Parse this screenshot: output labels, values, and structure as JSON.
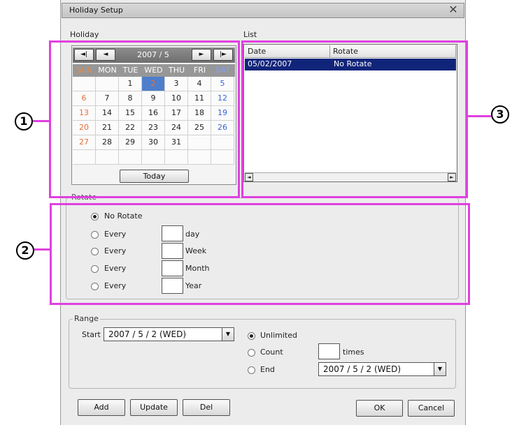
{
  "window": {
    "title": "Holiday Setup"
  },
  "holiday": {
    "section_label": "Holiday",
    "calendar": {
      "month_label": "2007 / 5",
      "nav": {
        "prev_year": "◄|",
        "prev_month": "◄",
        "next_month": "►",
        "next_year": "|►"
      },
      "weekdays": [
        "SUN",
        "MON",
        "TUE",
        "WED",
        "THU",
        "FRI",
        "SAT"
      ],
      "weeks": [
        [
          "",
          "",
          "1",
          "2",
          "3",
          "4",
          "5"
        ],
        [
          "6",
          "7",
          "8",
          "9",
          "10",
          "11",
          "12"
        ],
        [
          "13",
          "14",
          "15",
          "16",
          "17",
          "18",
          "19"
        ],
        [
          "20",
          "21",
          "22",
          "23",
          "24",
          "25",
          "26"
        ],
        [
          "27",
          "28",
          "29",
          "30",
          "31",
          "",
          ""
        ],
        [
          "",
          "",
          "",
          "",
          "",
          "",
          ""
        ]
      ],
      "selected_day": "2",
      "today_label": "Today"
    }
  },
  "list": {
    "section_label": "List",
    "columns": [
      "Date",
      "Rotate"
    ],
    "rows": [
      {
        "date": "05/02/2007",
        "rotate": "No Rotate"
      }
    ]
  },
  "rotate": {
    "group_label": "Rotate",
    "options": [
      {
        "label": "No Rotate",
        "unit": "",
        "checked": true
      },
      {
        "label": "Every",
        "unit": "day",
        "checked": false
      },
      {
        "label": "Every",
        "unit": "Week",
        "checked": false
      },
      {
        "label": "Every",
        "unit": "Month",
        "checked": false
      },
      {
        "label": "Every",
        "unit": "Year",
        "checked": false
      }
    ]
  },
  "range": {
    "group_label": "Range",
    "start_label": "Start",
    "start_value": "2007 / 5 / 2 (WED)",
    "options": {
      "unlimited": "Unlimited",
      "count": "Count",
      "count_unit": "times",
      "end": "End"
    },
    "end_value": "2007 / 5 / 2 (WED)"
  },
  "buttons": {
    "add": "Add",
    "update": "Update",
    "del": "Del",
    "ok": "OK",
    "cancel": "Cancel"
  },
  "callouts": {
    "c1": "1",
    "c2": "2",
    "c3": "3"
  },
  "colors": {
    "annotation": "#e040e0",
    "selection": "#10247a",
    "sunday": "#e8703a",
    "saturday": "#3a64d8"
  }
}
